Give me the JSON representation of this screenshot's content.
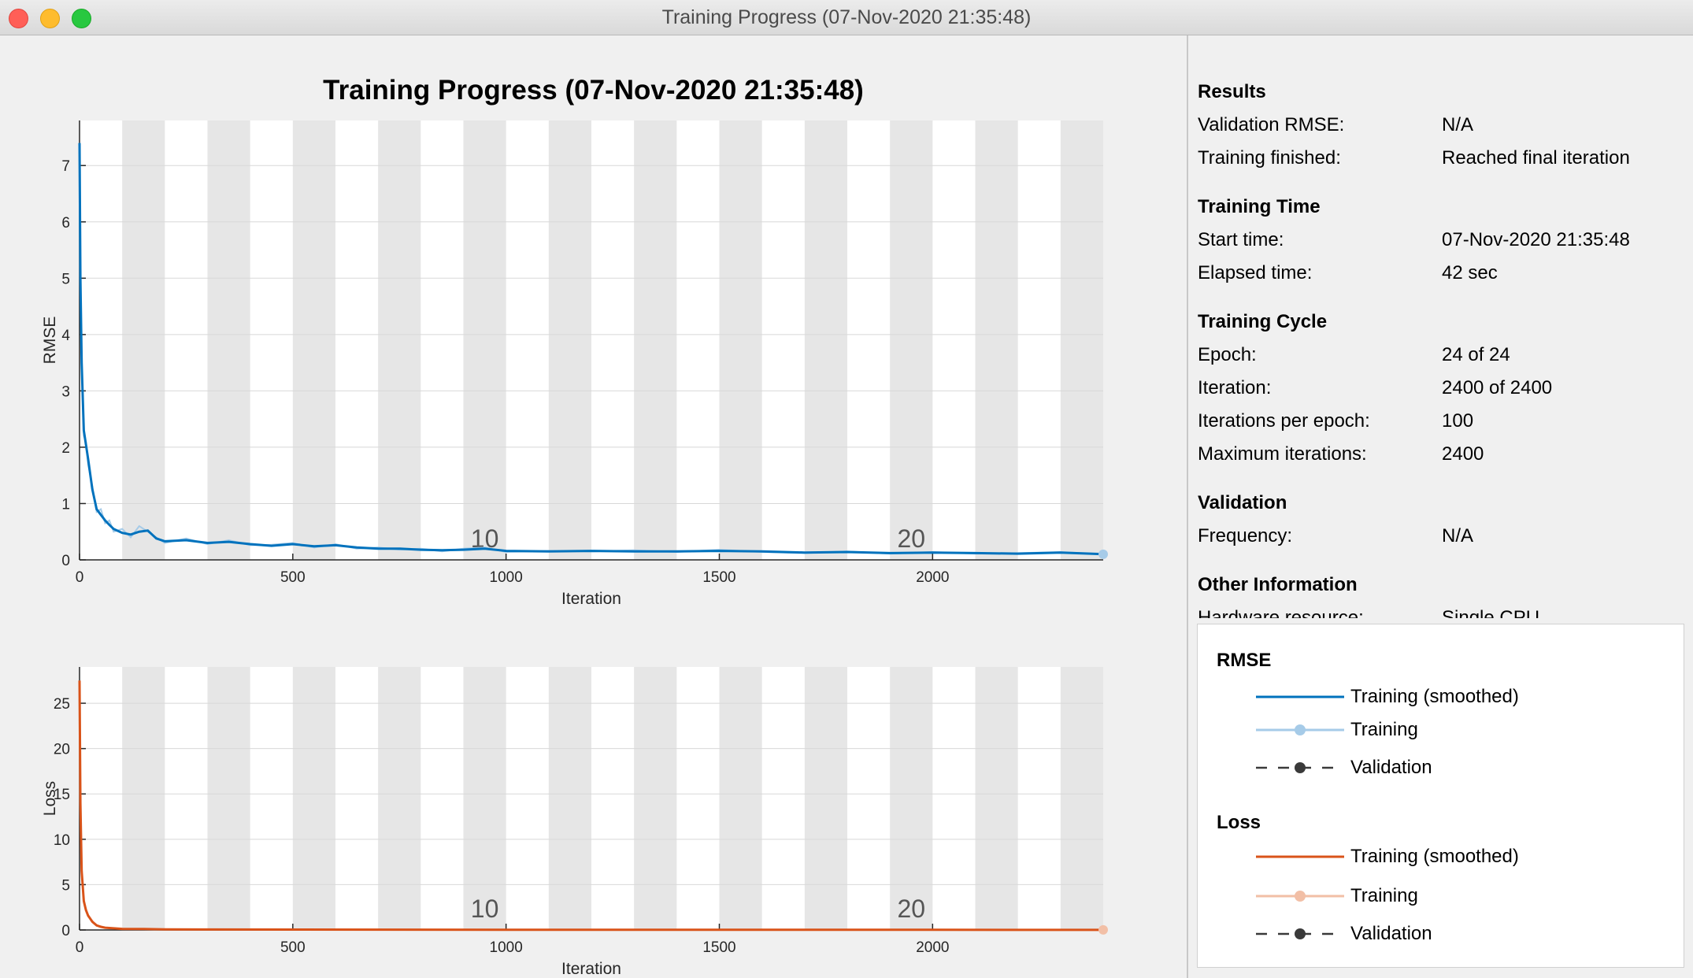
{
  "window": {
    "title": "Training Progress (07-Nov-2020 21:35:48)"
  },
  "plot": {
    "title": "Training Progress (07-Nov-2020 21:35:48)"
  },
  "colors": {
    "rmse_smoothed": "#0072bd",
    "rmse_raw": "#a6cbe8",
    "loss_smoothed": "#d95319",
    "loss_raw": "#f2bfa6",
    "validation": "#3a3a3a",
    "epoch_shade": "#e6e6e6"
  },
  "info": {
    "results": {
      "heading": "Results",
      "rows": [
        {
          "label": "Validation RMSE:",
          "value": "N/A"
        },
        {
          "label": "Training finished:",
          "value": "Reached final iteration"
        }
      ]
    },
    "training_time": {
      "heading": "Training Time",
      "rows": [
        {
          "label": "Start time:",
          "value": "07-Nov-2020 21:35:48"
        },
        {
          "label": "Elapsed time:",
          "value": "42 sec"
        }
      ]
    },
    "training_cycle": {
      "heading": "Training Cycle",
      "rows": [
        {
          "label": "Epoch:",
          "value": "24 of 24"
        },
        {
          "label": "Iteration:",
          "value": "2400 of 2400"
        },
        {
          "label": "Iterations per epoch:",
          "value": "100"
        },
        {
          "label": "Maximum iterations:",
          "value": "2400"
        }
      ]
    },
    "validation": {
      "heading": "Validation",
      "rows": [
        {
          "label": "Frequency:",
          "value": "N/A"
        }
      ]
    },
    "other": {
      "heading": "Other Information",
      "rows": [
        {
          "label": "Hardware resource:",
          "value": "Single CPU"
        }
      ]
    }
  },
  "legend": {
    "rmse": {
      "heading": "RMSE",
      "smoothed": "Training (smoothed)",
      "training": "Training",
      "validation": "Validation"
    },
    "loss": {
      "heading": "Loss",
      "smoothed": "Training (smoothed)",
      "training": "Training",
      "validation": "Validation"
    }
  },
  "chart_data": [
    {
      "type": "line",
      "title": "",
      "xlabel": "Iteration",
      "ylabel": "RMSE",
      "xlim": [
        0,
        2400
      ],
      "ylim": [
        0,
        7.8
      ],
      "xticks": [
        0,
        500,
        1000,
        1500,
        2000
      ],
      "yticks": [
        0,
        1,
        2,
        3,
        4,
        5,
        6,
        7
      ],
      "iterations_per_epoch": 100,
      "epoch_labels": [
        {
          "iteration": 950,
          "label": "10"
        },
        {
          "iteration": 1950,
          "label": "20"
        }
      ],
      "series": [
        {
          "name": "Training (smoothed)",
          "x": [
            0,
            2,
            5,
            10,
            15,
            20,
            30,
            40,
            50,
            60,
            70,
            80,
            100,
            120,
            140,
            160,
            180,
            200,
            250,
            300,
            350,
            400,
            450,
            500,
            550,
            600,
            650,
            700,
            750,
            800,
            850,
            900,
            950,
            1000,
            1100,
            1200,
            1300,
            1400,
            1500,
            1600,
            1700,
            1800,
            1900,
            2000,
            2100,
            2200,
            2300,
            2400
          ],
          "y": [
            7.4,
            5.0,
            3.5,
            2.3,
            2.05,
            1.8,
            1.25,
            0.9,
            0.8,
            0.7,
            0.62,
            0.55,
            0.48,
            0.45,
            0.5,
            0.52,
            0.38,
            0.33,
            0.35,
            0.3,
            0.32,
            0.28,
            0.25,
            0.28,
            0.24,
            0.26,
            0.22,
            0.2,
            0.2,
            0.18,
            0.17,
            0.18,
            0.2,
            0.16,
            0.15,
            0.16,
            0.15,
            0.15,
            0.16,
            0.15,
            0.13,
            0.14,
            0.12,
            0.13,
            0.12,
            0.11,
            0.13,
            0.1
          ]
        },
        {
          "name": "Training",
          "x": [
            0,
            2,
            5,
            10,
            15,
            20,
            30,
            40,
            50,
            60,
            70,
            80,
            100,
            120,
            140,
            160,
            180,
            200,
            250,
            300,
            350,
            400,
            450,
            500,
            550,
            600,
            650,
            700,
            750,
            800,
            850,
            900,
            950,
            1000,
            1100,
            1200,
            1300,
            1400,
            1500,
            1600,
            1700,
            1800,
            1900,
            2000,
            2100,
            2200,
            2300,
            2400
          ],
          "y": [
            7.4,
            5.0,
            3.6,
            2.2,
            2.1,
            1.7,
            1.3,
            0.85,
            0.9,
            0.65,
            0.7,
            0.5,
            0.55,
            0.4,
            0.6,
            0.5,
            0.4,
            0.3,
            0.38,
            0.28,
            0.35,
            0.26,
            0.27,
            0.3,
            0.22,
            0.28,
            0.2,
            0.22,
            0.18,
            0.2,
            0.15,
            0.2,
            0.22,
            0.14,
            0.16,
            0.15,
            0.17,
            0.14,
            0.18,
            0.14,
            0.12,
            0.15,
            0.11,
            0.14,
            0.11,
            0.12,
            0.14,
            0.1
          ]
        },
        {
          "name": "Validation",
          "x": [],
          "y": []
        }
      ]
    },
    {
      "type": "line",
      "title": "",
      "xlabel": "Iteration",
      "ylabel": "Loss",
      "xlim": [
        0,
        2400
      ],
      "ylim": [
        0,
        29
      ],
      "xticks": [
        0,
        500,
        1000,
        1500,
        2000
      ],
      "yticks": [
        0,
        5,
        10,
        15,
        20,
        25
      ],
      "iterations_per_epoch": 100,
      "epoch_labels": [
        {
          "iteration": 950,
          "label": "10"
        },
        {
          "iteration": 1950,
          "label": "20"
        }
      ],
      "series": [
        {
          "name": "Training (smoothed)",
          "x": [
            0,
            2,
            5,
            10,
            15,
            20,
            30,
            40,
            50,
            60,
            80,
            100,
            150,
            200,
            300,
            500,
            1000,
            1500,
            2000,
            2400
          ],
          "y": [
            27.5,
            14,
            6.5,
            3.2,
            2.2,
            1.6,
            0.9,
            0.5,
            0.35,
            0.25,
            0.18,
            0.12,
            0.1,
            0.06,
            0.05,
            0.04,
            0.02,
            0.02,
            0.02,
            0.01
          ]
        },
        {
          "name": "Training",
          "x": [
            0,
            2,
            5,
            10,
            15,
            20,
            30,
            40,
            50,
            60,
            80,
            100,
            150,
            200,
            300,
            500,
            1000,
            1500,
            2000,
            2400
          ],
          "y": [
            27.5,
            14,
            6.8,
            3.0,
            2.4,
            1.5,
            1.0,
            0.45,
            0.4,
            0.22,
            0.2,
            0.1,
            0.12,
            0.05,
            0.06,
            0.03,
            0.02,
            0.02,
            0.02,
            0.01
          ]
        },
        {
          "name": "Validation",
          "x": [],
          "y": []
        }
      ]
    }
  ]
}
